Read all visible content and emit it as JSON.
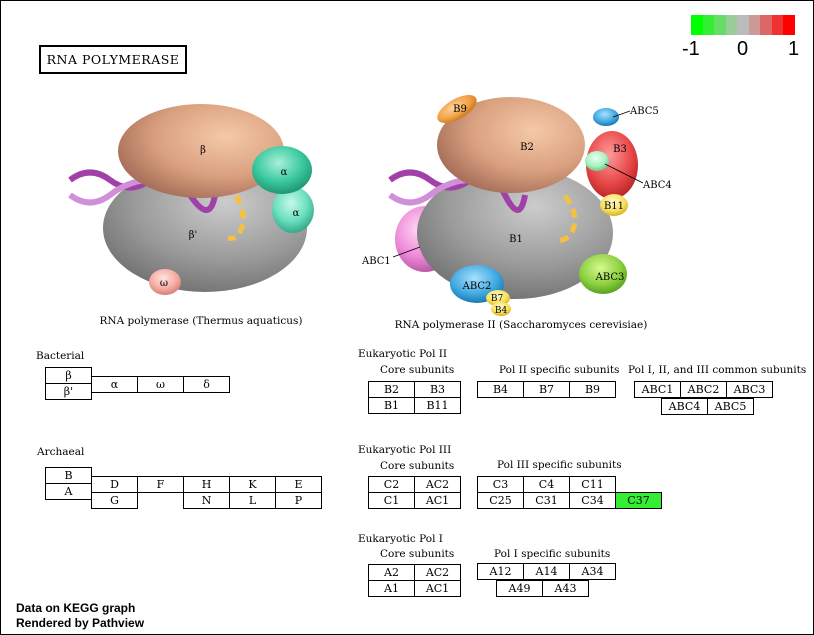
{
  "title": "RNA POLYMERASE",
  "legend": {
    "min_label": "-1",
    "mid_label": "0",
    "max_label": "1",
    "colors": [
      "#00ff00",
      "#33ee33",
      "#66dd66",
      "#99cc99",
      "#bbbbbb",
      "#cc9999",
      "#dd6666",
      "#ee3333",
      "#ff0000"
    ]
  },
  "left_structure": {
    "caption": "RNA polymerase (Thermus aquaticus)",
    "beta": "β",
    "beta_prime": "β'",
    "alpha1": "α",
    "alpha2": "α",
    "omega": "ω"
  },
  "right_structure": {
    "caption": "RNA polymerase II (Saccharomyces cerevisiae)",
    "b9": "B9",
    "abc5": "ABC5",
    "b2": "B2",
    "b3": "B3",
    "abc4": "ABC4",
    "b11": "B11",
    "b1": "B1",
    "abc1": "ABC1",
    "abc2": "ABC2",
    "abc3": "ABC3",
    "b7": "B7",
    "b4": "B4"
  },
  "bacterial": {
    "label": "Bacterial",
    "beta": "β",
    "beta_prime": "β'",
    "alpha": "α",
    "omega": "ω",
    "delta": "δ"
  },
  "archaeal": {
    "label": "Archaeal",
    "b": "B",
    "a": "A",
    "row1": [
      "D",
      "F",
      "H",
      "K",
      "E"
    ],
    "row2": [
      "G",
      "N",
      "L",
      "P"
    ]
  },
  "pol2": {
    "label": "Eukaryotic Pol II",
    "core_label": "Core subunits",
    "core": [
      "B2",
      "B3",
      "B1",
      "B11"
    ],
    "specific_label": "Pol II specific subunits",
    "specific": [
      "B4",
      "B7",
      "B9"
    ],
    "common_label": "Pol I, II, and III common subunits",
    "common": [
      "ABC1",
      "ABC2",
      "ABC3",
      "ABC4",
      "ABC5"
    ]
  },
  "pol3": {
    "label": "Eukaryotic Pol III",
    "core_label": "Core subunits",
    "core": [
      "C2",
      "AC2",
      "C1",
      "AC1"
    ],
    "specific_label": "Pol III specific subunits",
    "specific": [
      "C3",
      "C4",
      "C11",
      "C25",
      "C31",
      "C34",
      "C37"
    ],
    "highlight": "C37",
    "highlight_color": "#33ee33"
  },
  "pol1": {
    "label": "Eukaryotic Pol I",
    "core_label": "Core subunits",
    "core": [
      "A2",
      "AC2",
      "A1",
      "AC1"
    ],
    "specific_label": "Pol I specific subunits",
    "specific": [
      "A12",
      "A14",
      "A34",
      "A49",
      "A43"
    ]
  },
  "footer": {
    "line1": "Data on KEGG graph",
    "line2": "Rendered by Pathview"
  }
}
